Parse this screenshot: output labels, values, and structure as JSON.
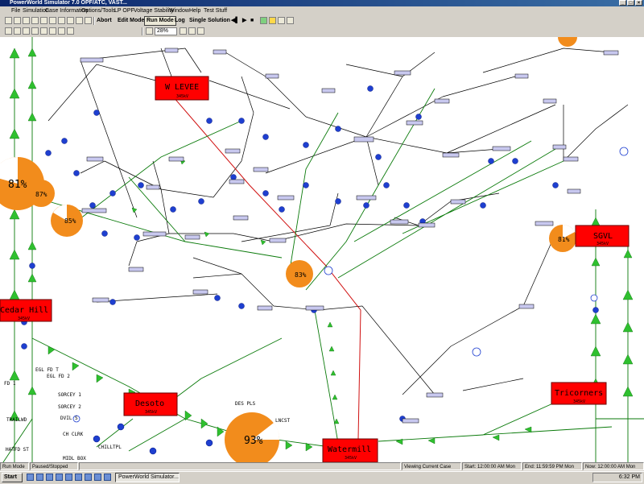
{
  "window": {
    "title": "PowerWorld Simulator 7.0 OPF/ATC, VAST..."
  },
  "menu": [
    "File",
    "Simulation",
    "Case Information",
    "Options/Tools",
    "LP OPF",
    "Voltage Stability",
    "Window",
    "Help",
    "Test Stuff"
  ],
  "toolbar": {
    "abort": "Abort",
    "edit_mode": "Edit Mode",
    "run_mode": "Run Mode",
    "log": "Log",
    "single_solution": "Single Solution",
    "zoom": "28%"
  },
  "diagram": {
    "big_buses": [
      {
        "name": "W LEVEE",
        "sub": "345kV"
      },
      {
        "name": "Cedar Hill",
        "sub": "345kV"
      },
      {
        "name": "SGVL",
        "sub": "345kV"
      },
      {
        "name": "Desoto",
        "sub": "345kV"
      },
      {
        "name": "Tricorners",
        "sub": "345kV"
      },
      {
        "name": "Watermill",
        "sub": "345kV"
      }
    ],
    "loadings": [
      "81%",
      "87%",
      "85%",
      "83%",
      "81%",
      "93%"
    ],
    "side_labels": [
      "EGL FD T",
      "EGL FD 2",
      "FD 1",
      "SORCEY 1",
      "SORCEY 2",
      "DVIL S",
      "TRAILWD",
      "CH CLRK",
      "CHILLTPL",
      "HATFD ST",
      "MIDL BOX",
      "DES PLS",
      "LNCST"
    ]
  },
  "status": {
    "mode": "Run Mode",
    "state": "Paused/Stopped",
    "viewing": "Viewing Current Case",
    "start": "Start: 12:00:00 AM Mon",
    "end": "End: 11:59:59 PM Mon",
    "now": "Now: 12:00:00 AM Mon"
  },
  "taskbar": {
    "start": "Start",
    "task": "PowerWorld Simulator...",
    "clock": "6:32 PM"
  },
  "colors": {
    "bus_fill": "#ff0000",
    "pie_fill": "#f28c1c",
    "flow_arrow": "#22bb22",
    "line": "#000000",
    "title_bar": "#0a246a"
  }
}
